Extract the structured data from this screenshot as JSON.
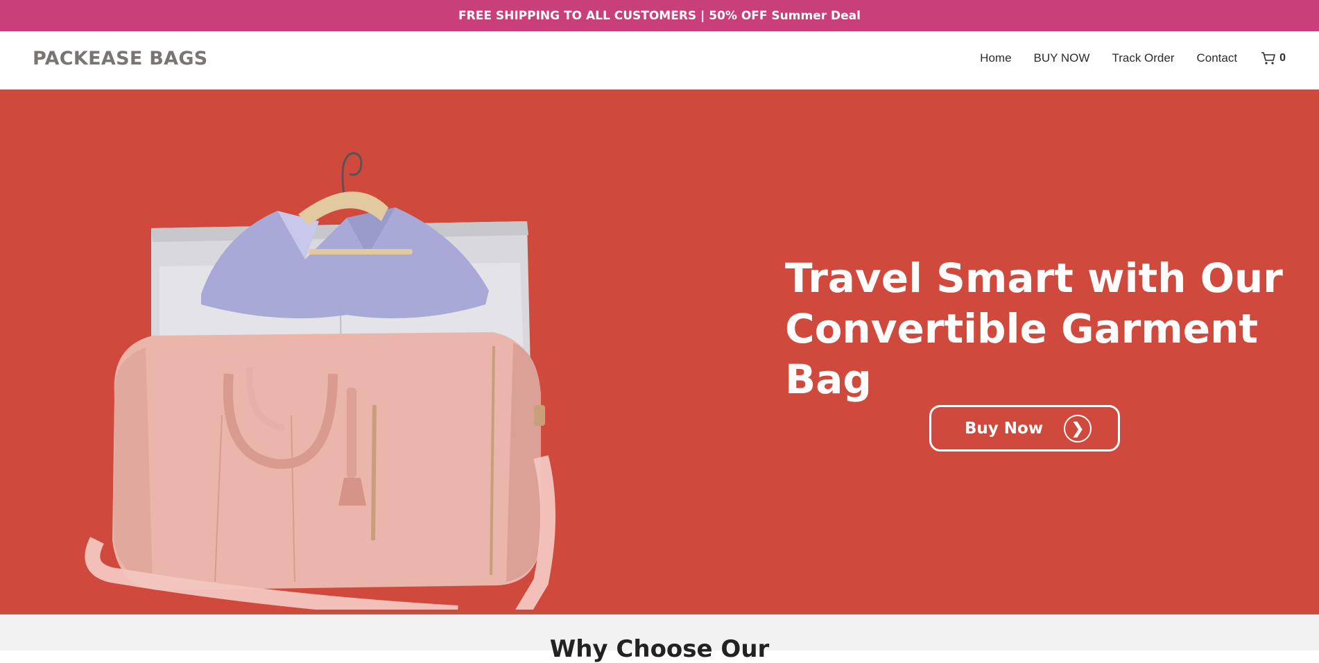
{
  "announcement": {
    "text": "FREE SHIPPING TO ALL CUSTOMERS | 50% OFF Summer Deal"
  },
  "header": {
    "logo": "PACKEASE BAGS",
    "nav": [
      {
        "label": "Home"
      },
      {
        "label": "BUY NOW"
      },
      {
        "label": "Track Order"
      },
      {
        "label": "Contact"
      }
    ],
    "cart": {
      "icon": "cart-icon",
      "count": "0"
    }
  },
  "hero": {
    "title": "Travel Smart with Our Convertible Garment Bag",
    "button": {
      "label": "Buy Now",
      "icon": "chevron-right-icon"
    },
    "image": "pink convertible garment duffel bag with hanger and lavender jacket"
  },
  "section": {
    "title": "Why Choose Our"
  },
  "colors": {
    "announce_bg": "#c93f7a",
    "hero_bg": "#cf4a3d",
    "logo": "#7a7472",
    "section_bg": "#f2f2f2"
  }
}
